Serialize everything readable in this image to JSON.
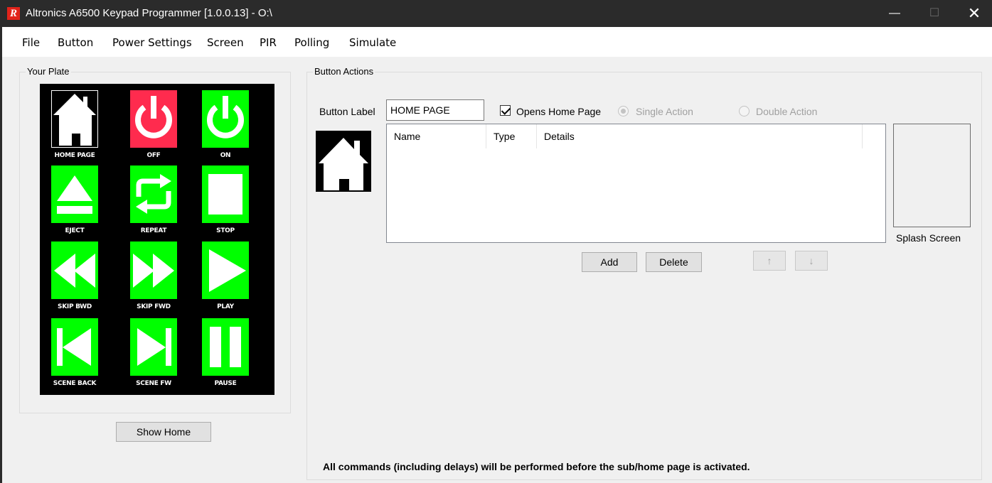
{
  "window": {
    "title": "Altronics A6500 Keypad Programmer [1.0.0.13]  - O:\\",
    "controls": {
      "minimize": "—",
      "maximize": "☐",
      "close": "✕"
    }
  },
  "menu": [
    "File",
    "Button",
    "Power Settings",
    "Screen",
    "PIR",
    "Polling",
    "Simulate"
  ],
  "plate": {
    "title": "Your Plate",
    "buttons": [
      {
        "label": "HOME PAGE",
        "icon": "home-icon",
        "bg": "#ffffff",
        "selected": true
      },
      {
        "label": "OFF",
        "icon": "power-icon",
        "bg": "#ff2b4e"
      },
      {
        "label": "ON",
        "icon": "power-icon",
        "bg": "#00ff00"
      },
      {
        "label": "EJECT",
        "icon": "eject-icon",
        "bg": "#00ff00"
      },
      {
        "label": "REPEAT",
        "icon": "repeat-icon",
        "bg": "#00ff00"
      },
      {
        "label": "STOP",
        "icon": "stop-icon",
        "bg": "#00ff00"
      },
      {
        "label": "SKIP BWD",
        "icon": "rewind-icon",
        "bg": "#00ff00"
      },
      {
        "label": "SKIP FWD",
        "icon": "fast-forward-icon",
        "bg": "#00ff00"
      },
      {
        "label": "PLAY",
        "icon": "play-icon",
        "bg": "#00ff00"
      },
      {
        "label": "SCENE BACK",
        "icon": "skip-back-icon",
        "bg": "#00ff00"
      },
      {
        "label": "SCENE FW",
        "icon": "skip-forward-icon",
        "bg": "#00ff00"
      },
      {
        "label": "PAUSE",
        "icon": "pause-icon",
        "bg": "#00ff00"
      }
    ],
    "show_home": "Show Home"
  },
  "actions": {
    "title": "Button Actions",
    "button_label_caption": "Button Label",
    "button_label_value": "HOME PAGE",
    "opens_home_page": "Opens Home Page",
    "opens_home_checked": true,
    "single_action": "Single Action",
    "double_action": "Double Action",
    "columns": [
      "Name",
      "Type",
      "Details"
    ],
    "add": "Add",
    "delete": "Delete",
    "move_up": "↑",
    "move_down": "↓",
    "splash_screen": "Splash Screen",
    "note": "All commands (including delays) will be performed before the sub/home page is activated."
  }
}
